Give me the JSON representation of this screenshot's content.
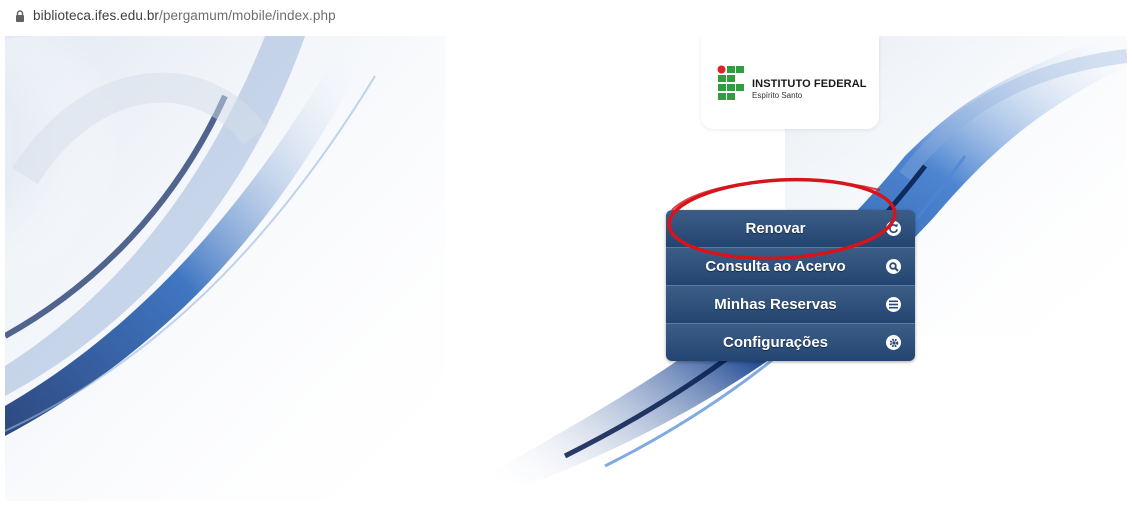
{
  "browser": {
    "url_host": "biblioteca.ifes.edu.br",
    "url_path": "/pergamum/mobile/index.php",
    "secure_icon": "lock-icon"
  },
  "logo": {
    "title": "INSTITUTO FEDERAL",
    "subtitle": "Espírito Santo",
    "colors": {
      "green": "#2e9e3e",
      "red": "#d9222a"
    }
  },
  "menu": {
    "items": [
      {
        "label": "Renovar",
        "icon": "refresh-icon"
      },
      {
        "label": "Consulta ao Acervo",
        "icon": "search-icon"
      },
      {
        "label": "Minhas Reservas",
        "icon": "list-icon"
      },
      {
        "label": "Configurações",
        "icon": "gear-icon"
      }
    ],
    "colors": {
      "top": "#3c5d86",
      "bottom": "#234571"
    }
  },
  "annotation": {
    "shape": "ellipse",
    "color": "#d7141c",
    "target": "Renovar"
  }
}
